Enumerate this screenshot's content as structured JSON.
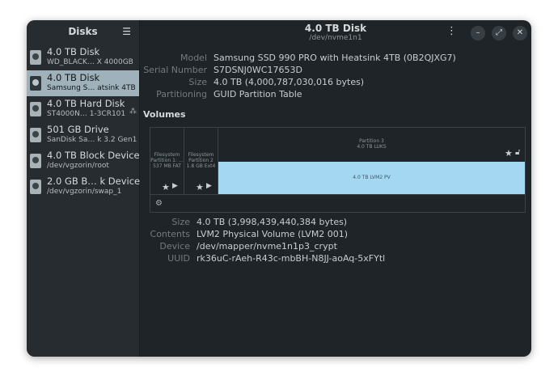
{
  "sidebar": {
    "title": "Disks",
    "menu_icon": "hamburger-icon",
    "items": [
      {
        "name": "4.0 TB Disk",
        "sub": "WD_BLACK… X 4000GB",
        "selected": false
      },
      {
        "name": "4.0 TB Disk",
        "sub": "Samsung S…  atsink 4TB",
        "selected": true
      },
      {
        "name": "4.0 TB Hard Disk",
        "sub": "ST4000N…  1-3CR101",
        "selected": false
      },
      {
        "name": "501 GB Drive",
        "sub": "SanDisk Sa…  k 3.2 Gen1",
        "selected": false
      },
      {
        "name": "4.0 TB Block Device",
        "sub": "/dev/vgzorin/root",
        "selected": false
      },
      {
        "name": "2.0 GB B…  k Device",
        "sub": "/dev/vgzorin/swap_1",
        "selected": false
      }
    ]
  },
  "header": {
    "title": "4.0 TB Disk",
    "subtitle": "/dev/nvme1n1"
  },
  "disk_info": {
    "model_label": "Model",
    "model": "Samsung SSD 990 PRO with Heatsink 4TB (0B2QJXG7)",
    "serial_label": "Serial Number",
    "serial": "S7DSNJ0WC17653D",
    "size_label": "Size",
    "size": "4.0 TB (4,000,787,030,016 bytes)",
    "partitioning_label": "Partitioning",
    "partitioning": "GUID Partition Table"
  },
  "volumes": {
    "heading": "Volumes",
    "partitions": [
      {
        "line1": "Filesystem",
        "line2": "Partition 1: …",
        "line3": "537 MB FAT"
      },
      {
        "line1": "Filesystem",
        "line2": "Partition 2",
        "line3": "1.8 GB Ext4"
      },
      {
        "line1": "Partition 3",
        "line2": "4.0 TB LUKS"
      }
    ],
    "lvm_label": "4.0 TB LVM2 PV"
  },
  "selected_volume": {
    "size_label": "Size",
    "size": "4.0 TB (3,998,439,440,384 bytes)",
    "contents_label": "Contents",
    "contents": "LVM2 Physical Volume (LVM2 001)",
    "device_label": "Device",
    "device": "/dev/mapper/nvme1n1p3_crypt",
    "uuid_label": "UUID",
    "uuid": "rk36uC-rAeh-R43c-mbBH-N8JJ-aoAq-5xFYtl"
  },
  "colors": {
    "window_bg": "#1e2428",
    "sidebar_bg": "#262c30",
    "selected_row": "#9fb1bb",
    "lvm_bar": "#a3d7f2"
  }
}
